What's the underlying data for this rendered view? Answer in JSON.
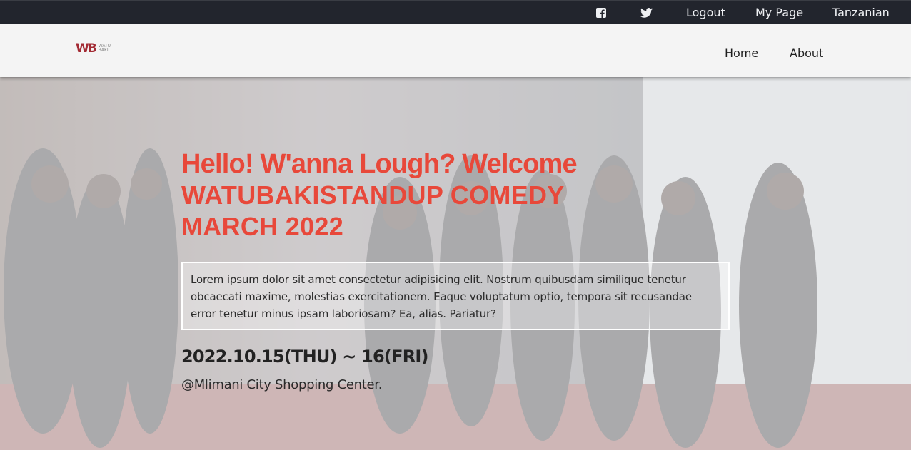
{
  "topbar": {
    "facebook_icon": "facebook-square-icon",
    "twitter_icon": "twitter-bird-icon",
    "logout": "Logout",
    "mypage": "My Page",
    "language": "Tanzanian"
  },
  "navbar": {
    "logo_mark": "WB",
    "logo_tag": "WATU BAKI",
    "links": [
      "Home",
      "About"
    ]
  },
  "hero": {
    "title_line1": "Hello! W'anna Lough? Welcome",
    "title_line2": "WATUBAKISTANDUP COMEDY",
    "title_line3": "MARCH 2022",
    "description": "Lorem ipsum dolor sit amet consectetur adipisicing elit. Nostrum quibusdam similique tenetur obcaecati maxime, molestias exercitationem. Eaque voluptatum optio, tempora sit recusandae error tenetur minus ipsam laboriosam? Ea, alias. Pariatur?",
    "date": "2022.10.15(THU) ~ 16(FRI)",
    "venue": "@Mlimani City Shopping Center."
  },
  "colors": {
    "topbar_bg": "#22252d",
    "accent_red": "#e8483a",
    "logo_red": "#a32b34"
  }
}
